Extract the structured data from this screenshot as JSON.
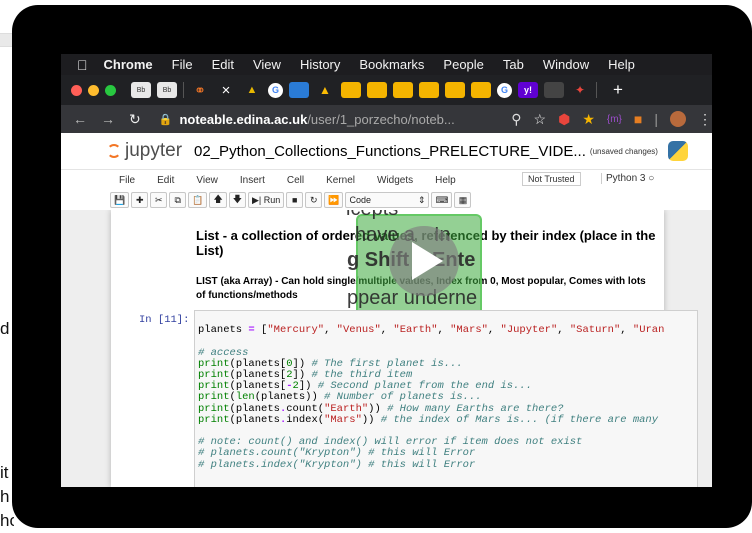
{
  "mac_menu": {
    "app": "Chrome",
    "items": [
      "File",
      "Edit",
      "View",
      "History",
      "Bookmarks",
      "People",
      "Tab",
      "Window",
      "Help"
    ]
  },
  "browser": {
    "tab_close": "×",
    "new_tab": "+",
    "address": {
      "host": "noteable.edina.ac.uk",
      "path": "/user/1_porzecho/noteb..."
    },
    "extension_label": "{m}"
  },
  "jupyter": {
    "logo_text": "jupyter",
    "notebook_title": "02_Python_Collections_Functions_PRELECTURE_VIDE...",
    "save_status": "(unsaved changes)",
    "menu": [
      "File",
      "Edit",
      "View",
      "Insert",
      "Cell",
      "Kernel",
      "Widgets",
      "Help"
    ],
    "trust": "Not Trusted",
    "kernel": "Python 3",
    "toolbar": {
      "run": "Run",
      "cell_type": "Code"
    }
  },
  "notebook": {
    "md_heading": "List - a collection of ordered values, referenced by their index (place in the List)",
    "md_para": "LIST (aka Array) - Can hold single/multiple values, Index from 0, Most popular, Comes with lots of functions/methods",
    "captions": [
      "icepts",
      "have a",
      "In",
      "g Shift + Ente",
      "ppear underne"
    ],
    "prompt": "In [11]:",
    "code_lines": [
      "planets = [\"Mercury\", \"Venus\", \"Earth\", \"Mars\", \"Jupyter\", \"Saturn\", \"Uran",
      "",
      "# access",
      "print(planets[0]) # The first planet is...",
      "print(planets[2]) # the third item",
      "print(planets[-2]) # Second planet from the end is...",
      "print(len(planets)) # Number of planets is...",
      "print(planets.count(\"Earth\")) # How many Earths are there?",
      "print(planets.index(\"Mars\")) # the index of Mars is... (if there are many ",
      "",
      "# note: count() and index() will error if item does not exist",
      "# planets.count(\"Krypton\") # this will Error",
      "# planets.index(\"Krypton\") # this will Error"
    ]
  },
  "background": {
    "fragments": [
      "d r",
      "it",
      "h",
      "ho"
    ]
  }
}
